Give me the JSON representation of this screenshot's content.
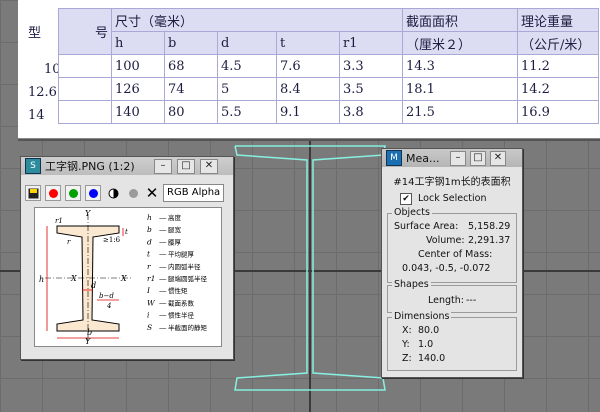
{
  "table": {
    "hdr_xing": "型",
    "hdr_hao": "号",
    "hdr_size": "尺寸（毫米）",
    "hdr_area": "截面面积",
    "hdr_area_unit": "（厘米２）",
    "hdr_weight": "理论重量",
    "hdr_weight_unit": "（公斤/米）",
    "sub": [
      "h",
      "b",
      "d",
      "t",
      "r1"
    ],
    "rows": [
      {
        "model": "10",
        "h": "100",
        "b": "68",
        "d": "4.5",
        "t": "7.6",
        "r1": "3.3",
        "area": "14.3",
        "weight": "11.2"
      },
      {
        "model": "12.6",
        "h": "126",
        "b": "74",
        "d": "5",
        "t": "8.4",
        "r1": "3.5",
        "area": "18.1",
        "weight": "14.2"
      },
      {
        "model": "14",
        "h": "140",
        "b": "80",
        "d": "5.5",
        "t": "9.1",
        "r1": "3.8",
        "area": "21.5",
        "weight": "16.9"
      }
    ]
  },
  "image_window": {
    "title": "工字钢.PNG (1:2)",
    "channel": "RGB Alpha",
    "legend": [
      {
        "k": "h",
        "v": "高度"
      },
      {
        "k": "b",
        "v": "腿宽"
      },
      {
        "k": "d",
        "v": "腰厚"
      },
      {
        "k": "t",
        "v": "平均腿厚"
      },
      {
        "k": "r",
        "v": "内圆弧半径"
      },
      {
        "k": "r1",
        "v": "腿端圆弧半径"
      },
      {
        "k": "I",
        "v": "惯性矩"
      },
      {
        "k": "W",
        "v": "截面系数"
      },
      {
        "k": "i",
        "v": "惯性半径"
      },
      {
        "k": "S",
        "v": "半截面的静矩"
      }
    ],
    "labels": {
      "y": "Y",
      "x": "X",
      "h": "h",
      "b": "b",
      "d": "d",
      "t": "t",
      "r": "r",
      "r1": "r1",
      "slope": "≥1:6",
      "bd": "b−d",
      "four": "4"
    },
    "colors": {
      "red": "#ff0000",
      "green": "#00a000",
      "blue": "#0000ff"
    }
  },
  "measure_window": {
    "title": "Mea...",
    "object_name": "#14工字钢1m长的表面积",
    "lock_label": "Lock Selection",
    "lock_checked": true,
    "objects_label": "Objects",
    "surface_area_label": "Surface Area:",
    "surface_area": "5,158.29",
    "volume_label": "Volume:",
    "volume": "2,291.37",
    "center_label": "Center of Mass:",
    "center": "0.043, -0.5, -0.072",
    "shapes_label": "Shapes",
    "length_label": "Length:",
    "length": "---",
    "dimensions_label": "Dimensions",
    "dim_x_label": "X:",
    "dim_x": "80.0",
    "dim_y_label": "Y:",
    "dim_y": "1.0",
    "dim_z_label": "Z:",
    "dim_z": "140.0"
  },
  "window_buttons": {
    "min": "–",
    "max": "□",
    "close": "✕"
  }
}
